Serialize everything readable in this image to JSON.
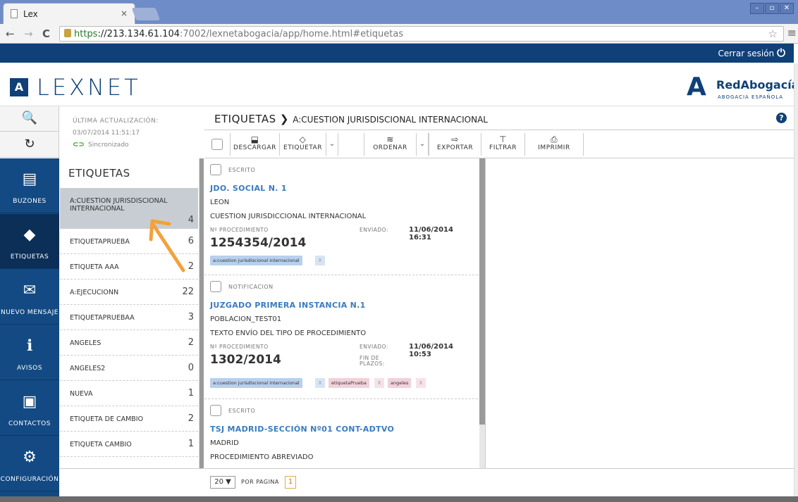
{
  "browser": {
    "tab_title": "Lex",
    "tab_close": "×",
    "url_scheme": "https",
    "url_host": "://213.134.61.104",
    "url_rest": ":7002/lexnetabogacia/app/home.html#etiquetas",
    "back": "←",
    "forward": "→",
    "reload": "C",
    "star": "☆",
    "menu": "≡"
  },
  "header": {
    "logout_label": "Cerrar sesión",
    "logo_letter": "A",
    "logo_text": "LEXNET",
    "partner_mark": "A",
    "partner_name": "RedAbogacía",
    "partner_sub": "ABOGACIA ESPAÑOLA"
  },
  "rail": {
    "search": "🔍",
    "refresh": "↻",
    "items": [
      {
        "label": "BUZONES",
        "icon": "inbox-icon",
        "glyph": "▤"
      },
      {
        "label": "ETIQUETAS",
        "icon": "tag-icon",
        "glyph": "◆"
      },
      {
        "label": "NUEVO MENSAJE",
        "icon": "new-mail-icon",
        "glyph": "✉"
      },
      {
        "label": "AVISOS",
        "icon": "alert-icon",
        "glyph": "ℹ"
      },
      {
        "label": "CONTACTOS",
        "icon": "contacts-icon",
        "glyph": "▣"
      },
      {
        "label": "CONFIGURACIÓN",
        "icon": "gear-icon",
        "glyph": "⚙"
      }
    ]
  },
  "sync": {
    "label": "ÚLTIMA ACTUALIZACIÓN:",
    "datetime": "03/07/2014 11:51:17",
    "status": "Sincronizado"
  },
  "tags": {
    "title": "ETIQUETAS",
    "items": [
      {
        "name": "A:CUESTION JURISDISCIONAL INTERNACIONAL",
        "count": "4"
      },
      {
        "name": "ETIQUETAPRUEBA",
        "count": "6"
      },
      {
        "name": "ETIQUETA AAA",
        "count": "2"
      },
      {
        "name": "A:EJECUCIONN",
        "count": "22"
      },
      {
        "name": "ETIQUETAPRUEBAA",
        "count": "3"
      },
      {
        "name": "ANGELES",
        "count": "2"
      },
      {
        "name": "ANGELES2",
        "count": "0"
      },
      {
        "name": "NUEVA",
        "count": "1"
      },
      {
        "name": "ETIQUETA DE CAMBIO",
        "count": "2"
      },
      {
        "name": "ETIQUETA CAMBIO",
        "count": "1"
      }
    ]
  },
  "breadcrumb": {
    "root": "ETIQUETAS",
    "sep": "❯",
    "current": "A:CUESTION JURISDISCIONAL INTERNACIONAL",
    "help": "?"
  },
  "toolbar": {
    "descargar": "DESCARGAR",
    "etiquetar": "ETIQUETAR",
    "ordenar": "ORDENAR",
    "exportar": "EXPORTAR",
    "filtrar": "FILTRAR",
    "imprimir": "IMPRIMIR"
  },
  "messages": [
    {
      "type": "ESCRITO",
      "court": "JDO. SOCIAL N. 1",
      "place": "LEON",
      "subject": "CUESTION JURISDICCIONAL INTERNACIONAL",
      "proc_label": "Nº PROCEDIMIENTO",
      "sent_label": "ENVIADO:",
      "sent": "11/06/2014 16:31",
      "number": "1254354/2014",
      "chips": [
        {
          "text": "a:cuestion jurisdiscional internacional",
          "color": "blue"
        }
      ]
    },
    {
      "type": "NOTIFICACION",
      "court": "JUZGADO PRIMERA INSTANCIA N.1",
      "place": "POBLACION_TEST01",
      "subject": "TEXTO ENVÍO DEL TIPO DE PROCEDIMIENTO",
      "proc_label": "Nº PROCEDIMIENTO",
      "sent_label": "ENVIADO:",
      "sent": "11/06/2014 10:53",
      "number": "1302/2014",
      "deadline_label": "FIN DE PLAZOS:",
      "chips": [
        {
          "text": "a:cuestion jurisdiscional internacional",
          "color": "blue"
        },
        {
          "text": "etiquetaPrueba",
          "color": "pink"
        },
        {
          "text": "angeles",
          "color": "pink"
        }
      ]
    },
    {
      "type": "ESCRITO",
      "court": "TSJ MADRID-SECCIÓN Nº01 CONT-ADTVO",
      "place": "MADRID",
      "subject": "PROCEDIMIENTO ABREVIADO"
    }
  ],
  "footer": {
    "per_page": "20 ▼",
    "per_page_label": "POR PAGINA",
    "page": "1"
  },
  "colors": {
    "brand": "#0f4077",
    "link": "#3a7bc0",
    "chip_blue": "#b7d0ee",
    "chip_pink": "#f3d1da",
    "arrow": "#f2a23c"
  }
}
